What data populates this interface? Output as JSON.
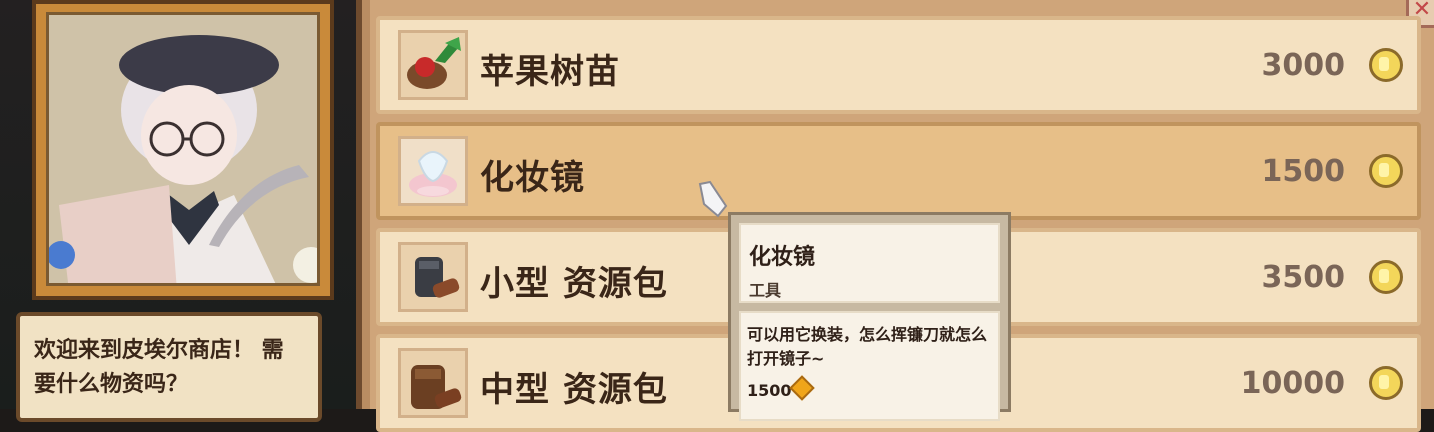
{
  "merchant": {
    "greeting": "欢迎来到皮埃尔商店！ 需\n要什么物资吗？"
  },
  "shop": {
    "close_label": "✕",
    "items": [
      {
        "name": "苹果树苗",
        "price": "3000",
        "icon": "apple-sapling-icon"
      },
      {
        "name": "化妆镜",
        "price": "1500",
        "icon": "vanity-mirror-icon",
        "selected": true
      },
      {
        "name": "小型 资源包",
        "price": "3500",
        "icon": "small-resource-pack-icon"
      },
      {
        "name": "中型 资源包",
        "price": "10000",
        "icon": "medium-resource-pack-icon"
      }
    ]
  },
  "tooltip": {
    "title": "化妆镜",
    "type": "工具",
    "description": "可以用它换装，怎么挥镰刀就怎么打开镜子~",
    "price": "1500"
  },
  "colors": {
    "row_bg": "#f4e1c1",
    "row_selected": "#e7bf88",
    "text_dark": "#3a2618",
    "price_text": "#7a6557",
    "coin_gold": "#f3d65a"
  }
}
